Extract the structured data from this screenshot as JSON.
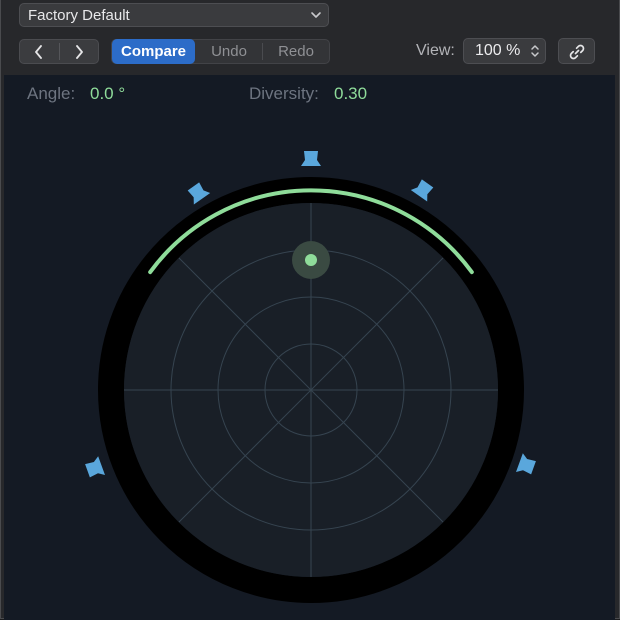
{
  "preset": {
    "name": "Factory Default"
  },
  "toolbar": {
    "prev_icon": "chevron-left-icon",
    "next_icon": "chevron-right-icon",
    "compare_label": "Compare",
    "undo_label": "Undo",
    "redo_label": "Redo",
    "view_label": "View:",
    "zoom_value": "100 %",
    "link_icon": "link-icon"
  },
  "params": {
    "angle_label": "Angle:",
    "angle_value": "0.0 °",
    "diversity_label": "Diversity:",
    "diversity_value": "0.30"
  },
  "colors": {
    "accent": "#2c6cc8",
    "value_green": "#8fdc9a",
    "speaker_blue": "#5aa7dc",
    "panel_bg": "#141a24"
  }
}
